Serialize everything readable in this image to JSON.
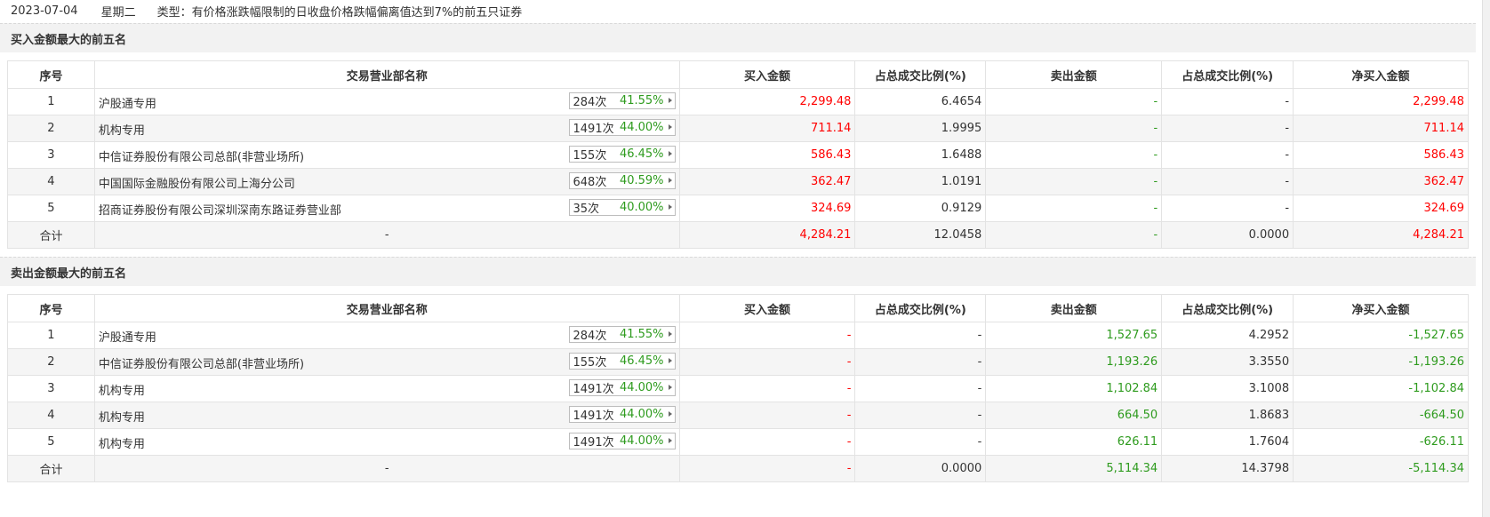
{
  "info": {
    "date": "2023-07-04",
    "weekday": "星期二",
    "type_text": "类型：有价格涨跌幅限制的日收盘价格跌幅偏离值达到7%的前五只证券"
  },
  "headers": {
    "seq": "序号",
    "dept": "交易营业部名称",
    "buy": "买入金额",
    "buy_pct": "占总成交比例(%)",
    "sell": "卖出金额",
    "sell_pct": "占总成交比例(%)",
    "net": "净买入金额"
  },
  "colors": {
    "red": "#ff0000",
    "green": "#2e9b1e"
  },
  "buy_section": {
    "title": "买入金额最大的前五名",
    "rows": [
      {
        "seq": "1",
        "name": "沪股通专用",
        "count": "284次",
        "rate": "41.55%",
        "buy": "2,299.48",
        "buy_pct": "6.4654",
        "sell": "-",
        "sell_pct": "-",
        "net": "2,299.48"
      },
      {
        "seq": "2",
        "name": "机构专用",
        "count": "1491次",
        "rate": "44.00%",
        "buy": "711.14",
        "buy_pct": "1.9995",
        "sell": "-",
        "sell_pct": "-",
        "net": "711.14"
      },
      {
        "seq": "3",
        "name": "中信证券股份有限公司总部(非营业场所)",
        "count": "155次",
        "rate": "46.45%",
        "buy": "586.43",
        "buy_pct": "1.6488",
        "sell": "-",
        "sell_pct": "-",
        "net": "586.43"
      },
      {
        "seq": "4",
        "name": "中国国际金融股份有限公司上海分公司",
        "count": "648次",
        "rate": "40.59%",
        "buy": "362.47",
        "buy_pct": "1.0191",
        "sell": "-",
        "sell_pct": "-",
        "net": "362.47"
      },
      {
        "seq": "5",
        "name": "招商证券股份有限公司深圳深南东路证券营业部",
        "count": "35次",
        "rate": "40.00%",
        "buy": "324.69",
        "buy_pct": "0.9129",
        "sell": "-",
        "sell_pct": "-",
        "net": "324.69"
      }
    ],
    "total": {
      "seq": "合计",
      "name": "-",
      "buy": "4,284.21",
      "buy_pct": "12.0458",
      "sell": "-",
      "sell_pct": "0.0000",
      "net": "4,284.21"
    }
  },
  "sell_section": {
    "title": "卖出金额最大的前五名",
    "rows": [
      {
        "seq": "1",
        "name": "沪股通专用",
        "count": "284次",
        "rate": "41.55%",
        "buy": "-",
        "buy_pct": "-",
        "sell": "1,527.65",
        "sell_pct": "4.2952",
        "net": "-1,527.65"
      },
      {
        "seq": "2",
        "name": "中信证券股份有限公司总部(非营业场所)",
        "count": "155次",
        "rate": "46.45%",
        "buy": "-",
        "buy_pct": "-",
        "sell": "1,193.26",
        "sell_pct": "3.3550",
        "net": "-1,193.26"
      },
      {
        "seq": "3",
        "name": "机构专用",
        "count": "1491次",
        "rate": "44.00%",
        "buy": "-",
        "buy_pct": "-",
        "sell": "1,102.84",
        "sell_pct": "3.1008",
        "net": "-1,102.84"
      },
      {
        "seq": "4",
        "name": "机构专用",
        "count": "1491次",
        "rate": "44.00%",
        "buy": "-",
        "buy_pct": "-",
        "sell": "664.50",
        "sell_pct": "1.8683",
        "net": "-664.50"
      },
      {
        "seq": "5",
        "name": "机构专用",
        "count": "1491次",
        "rate": "44.00%",
        "buy": "-",
        "buy_pct": "-",
        "sell": "626.11",
        "sell_pct": "1.7604",
        "net": "-626.11"
      }
    ],
    "total": {
      "seq": "合计",
      "name": "-",
      "buy": "-",
      "buy_pct": "0.0000",
      "sell": "5,114.34",
      "sell_pct": "14.3798",
      "net": "-5,114.34"
    }
  }
}
